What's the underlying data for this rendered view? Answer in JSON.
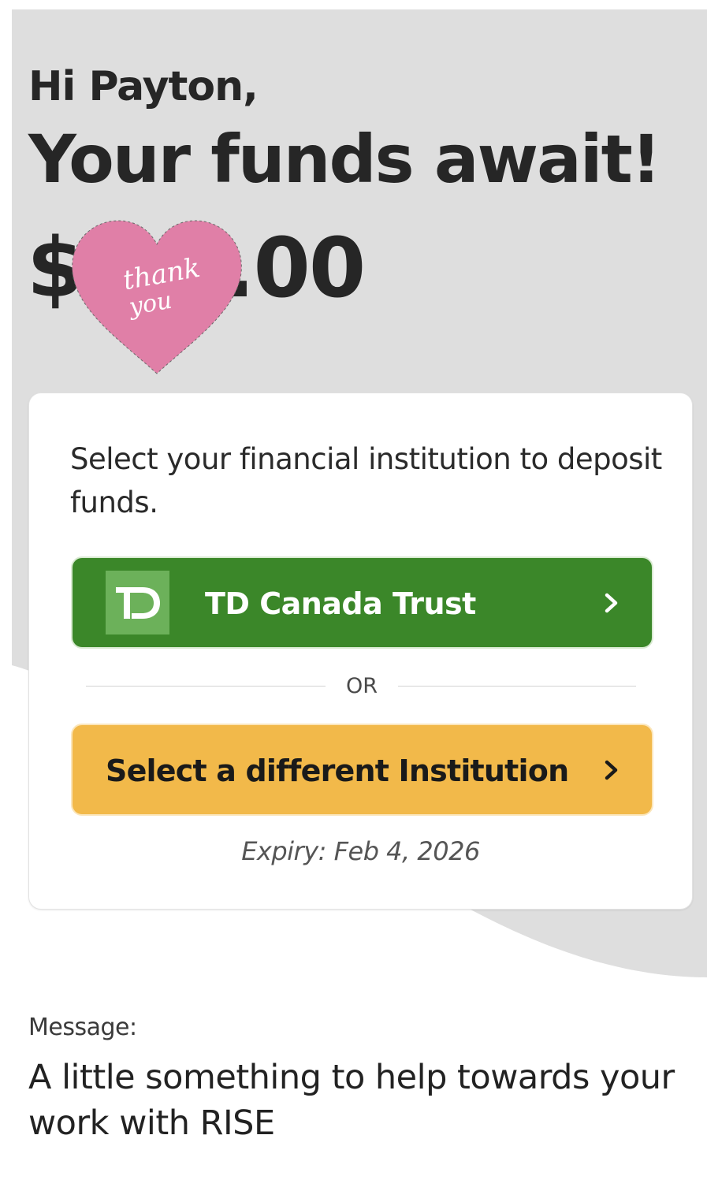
{
  "header": {
    "greeting": "Hi Payton,",
    "headline": "Your funds await!"
  },
  "amount": {
    "currency_symbol": "$",
    "cents": ".00",
    "sticker": {
      "line1": "thank",
      "line2": "you",
      "color": "#e07fa7"
    }
  },
  "card": {
    "instruction": "Select your financial institution to deposit funds.",
    "primary_institution": {
      "logo_text": "TD",
      "label": "TD Canada Trust",
      "color": "#3b8729"
    },
    "separator": "OR",
    "secondary_button": {
      "label": "Select a different Institution",
      "color": "#f2b94a"
    },
    "expiry": "Expiry: Feb 4, 2026"
  },
  "message": {
    "label": "Message:",
    "body": "A little something to help towards your work with RISE"
  }
}
